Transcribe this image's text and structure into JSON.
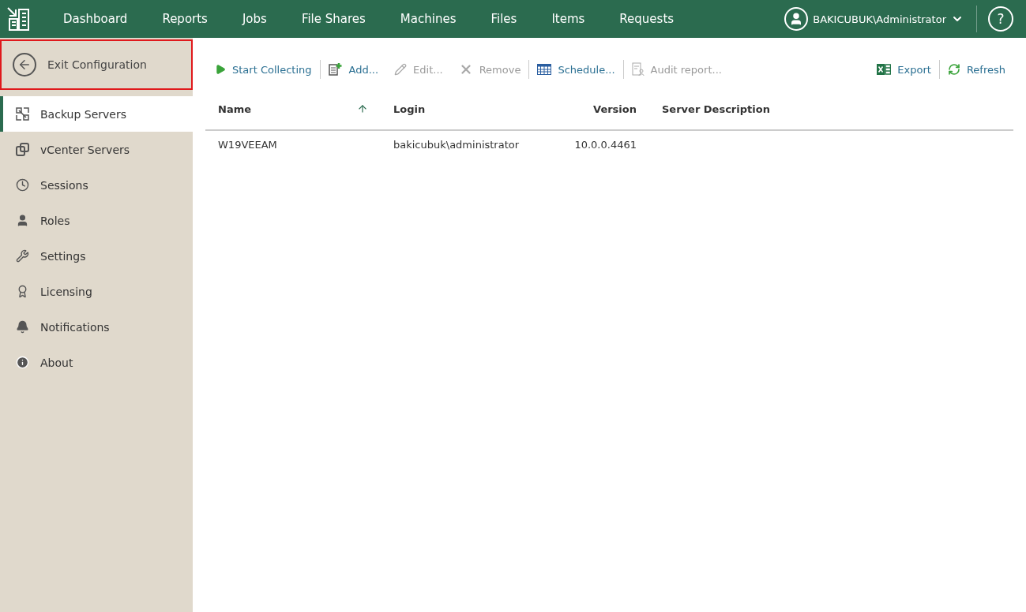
{
  "topbar": {
    "nav": [
      {
        "label": "Dashboard"
      },
      {
        "label": "Reports"
      },
      {
        "label": "Jobs"
      },
      {
        "label": "File Shares"
      },
      {
        "label": "Machines"
      },
      {
        "label": "Files"
      },
      {
        "label": "Items"
      },
      {
        "label": "Requests"
      }
    ],
    "user": "BAKICUBUK\\Administrator",
    "help": "?"
  },
  "sidebar": {
    "exit": {
      "label": "Exit Configuration",
      "highlighted": true
    },
    "items": [
      {
        "label": "Backup Servers",
        "kind": "backup",
        "selected": true
      },
      {
        "label": "vCenter Servers",
        "kind": "vcenter",
        "selected": false
      },
      {
        "label": "Sessions",
        "kind": "clock",
        "selected": false
      },
      {
        "label": "Roles",
        "kind": "user",
        "selected": false
      },
      {
        "label": "Settings",
        "kind": "tools",
        "selected": false
      },
      {
        "label": "Licensing",
        "kind": "award",
        "selected": false
      },
      {
        "label": "Notifications",
        "kind": "bell",
        "selected": false
      },
      {
        "label": "About",
        "kind": "info",
        "selected": false
      }
    ]
  },
  "toolbar": {
    "left": [
      {
        "label": "Start Collecting",
        "kind": "play",
        "disabled": false
      },
      {
        "label": "Add...",
        "kind": "add",
        "disabled": false
      },
      {
        "label": "Edit...",
        "kind": "edit",
        "disabled": true
      },
      {
        "label": "Remove",
        "kind": "remove",
        "disabled": true
      },
      {
        "label": "Schedule...",
        "kind": "calendar",
        "disabled": false
      },
      {
        "label": "Audit report...",
        "kind": "audit",
        "disabled": true
      }
    ],
    "right": [
      {
        "label": "Export",
        "kind": "excel",
        "disabled": false
      },
      {
        "label": "Refresh",
        "kind": "refresh",
        "disabled": false
      }
    ]
  },
  "table": {
    "columns": [
      {
        "label": "Name",
        "sorted": true
      },
      {
        "label": "Login",
        "sorted": false
      },
      {
        "label": "Version",
        "sorted": false
      },
      {
        "label": "Server Description",
        "sorted": false
      }
    ],
    "rows": [
      [
        "W19VEEAM",
        "bakicubuk\\administrator",
        "10.0.0.4461",
        ""
      ]
    ]
  }
}
